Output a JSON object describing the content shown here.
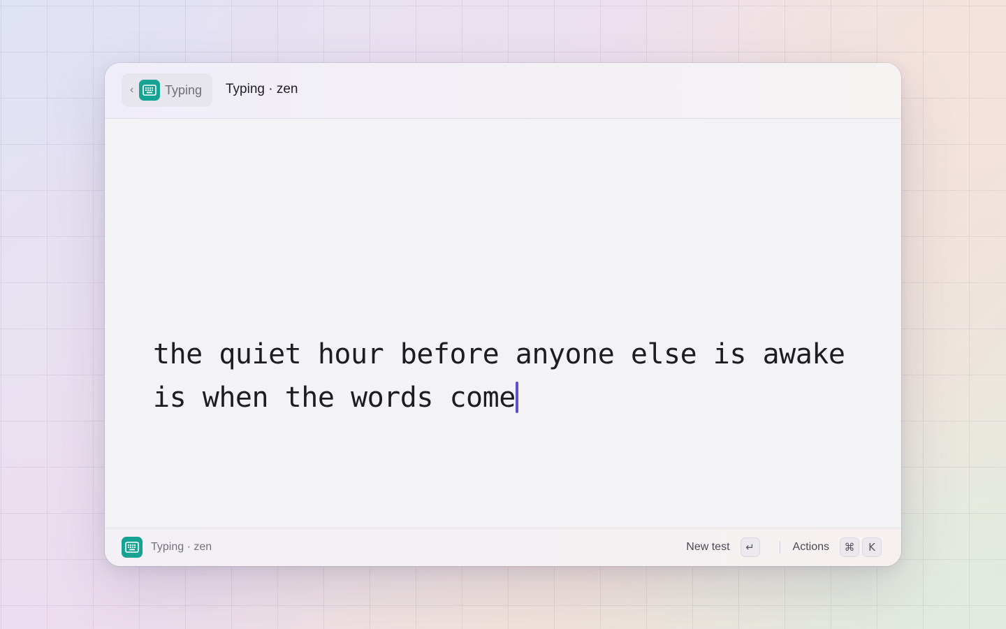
{
  "header": {
    "back_label": "Typing",
    "back_chevron": "‹",
    "title": "Typing · zen"
  },
  "editor": {
    "lines": [
      "the quiet hour before anyone else is awake",
      "is when the words come"
    ],
    "caret_color": "#5b4fd0"
  },
  "footer": {
    "app_label": "Typing · zen",
    "new_test_label": "New test",
    "new_test_key": "↵",
    "actions_label": "Actions",
    "actions_keys": [
      "⌘",
      "K"
    ]
  },
  "colors": {
    "accent": "#17a394"
  },
  "icons": {
    "app": "keyboard-icon",
    "back": "chevron-left-icon"
  }
}
